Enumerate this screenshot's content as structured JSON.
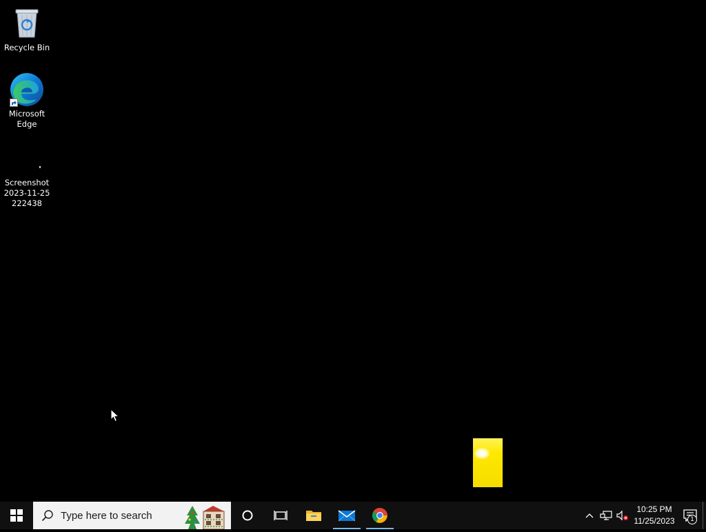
{
  "desktop": {
    "icons": [
      {
        "label": "Recycle Bin",
        "icon": "recycle-bin-icon"
      },
      {
        "label": "Microsoft\nEdge",
        "icon": "edge-icon"
      },
      {
        "label": "Screenshot\n2023-11-25\n222438",
        "icon": "image-file-icon"
      }
    ]
  },
  "taskbar": {
    "search_placeholder": "Type here to search",
    "pinned": [
      {
        "name": "Cortana",
        "icon": "cortana-circle-icon",
        "active": false
      },
      {
        "name": "Task View",
        "icon": "task-view-icon",
        "active": false
      },
      {
        "name": "File Explorer",
        "icon": "folder-icon",
        "active": false
      },
      {
        "name": "Mail",
        "icon": "mail-icon",
        "active": true
      },
      {
        "name": "Google Chrome",
        "icon": "chrome-icon",
        "active": true
      }
    ],
    "clock": {
      "time": "10:25 PM",
      "date": "11/25/2023"
    },
    "notification_count": "1"
  },
  "colors": {
    "desktop_bg": "#000000",
    "taskbar_bg": "#101010",
    "active_indicator": "#76b9ed",
    "highlight_yellow": "#ffe800"
  }
}
